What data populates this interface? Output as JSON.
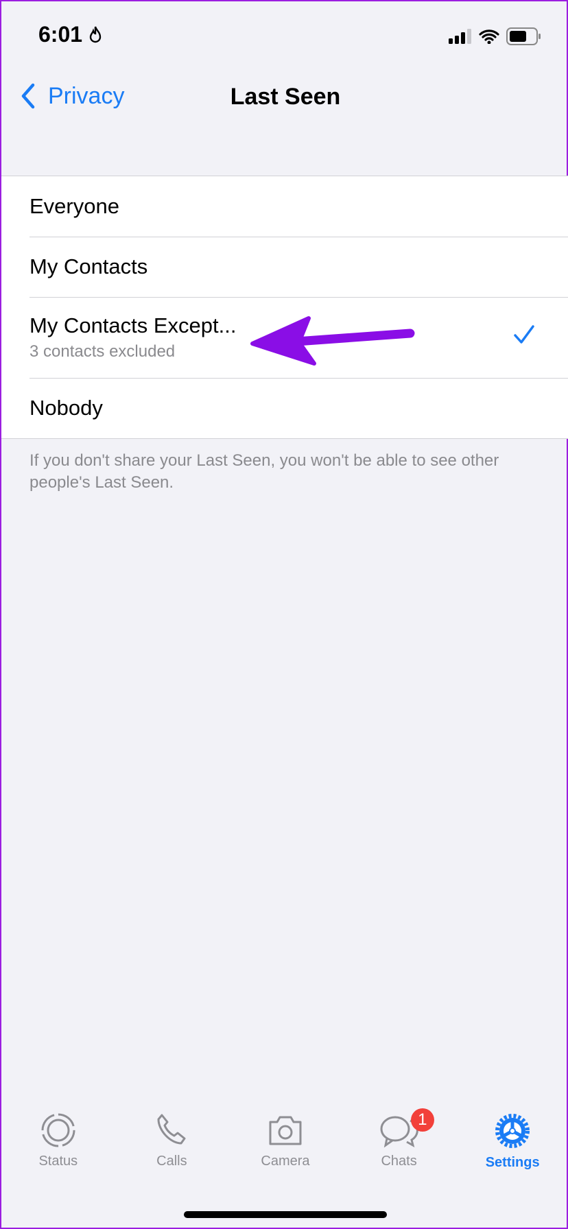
{
  "status_bar": {
    "time": "6:01"
  },
  "nav": {
    "back_label": "Privacy",
    "title": "Last Seen"
  },
  "options": [
    {
      "label": "Everyone",
      "selected": false
    },
    {
      "label": "My Contacts",
      "selected": false
    },
    {
      "label": "My Contacts Except...",
      "subtitle": "3 contacts excluded",
      "selected": true
    },
    {
      "label": "Nobody",
      "selected": false
    }
  ],
  "footer": "If you don't share your Last Seen, you won't be able to see other people's Last Seen.",
  "tabs": [
    {
      "label": "Status",
      "icon": "status-icon"
    },
    {
      "label": "Calls",
      "icon": "phone-icon"
    },
    {
      "label": "Camera",
      "icon": "camera-icon"
    },
    {
      "label": "Chats",
      "icon": "chats-icon",
      "badge": "1"
    },
    {
      "label": "Settings",
      "icon": "settings-gear-icon",
      "active": true
    }
  ],
  "colors": {
    "accent": "#1a7cf5",
    "annotation_arrow": "#8a0ee6",
    "badge": "#f2403a"
  }
}
